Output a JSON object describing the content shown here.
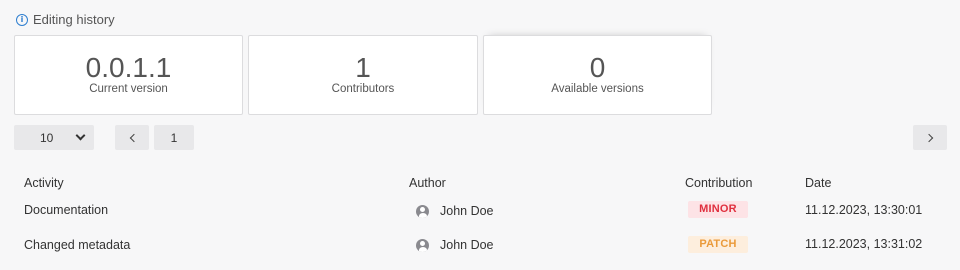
{
  "section": {
    "title": "Editing history",
    "icon": "info-icon"
  },
  "stats": [
    {
      "value": "0.0.1.1",
      "label": "Current version"
    },
    {
      "value": "1",
      "label": "Contributors"
    },
    {
      "value": "0",
      "label": "Available versions"
    }
  ],
  "pagination": {
    "page_size": "10",
    "current_page": "1"
  },
  "table": {
    "headers": {
      "activity": "Activity",
      "author": "Author",
      "contribution": "Contribution",
      "date": "Date"
    },
    "rows": [
      {
        "activity": "Documentation",
        "author": "John Doe",
        "contribution": "MINOR",
        "date": "11.12.2023, 13:30:01"
      },
      {
        "activity": "Changed metadata",
        "author": "John Doe",
        "contribution": "PATCH",
        "date": "11.12.2023, 13:31:02"
      }
    ]
  },
  "colors": {
    "minor_text": "#e0303f",
    "minor_bg": "#fde3e6",
    "patch_text": "#ea9a3a",
    "patch_bg": "#fdeedd",
    "info_icon": "#2f7fd0"
  }
}
